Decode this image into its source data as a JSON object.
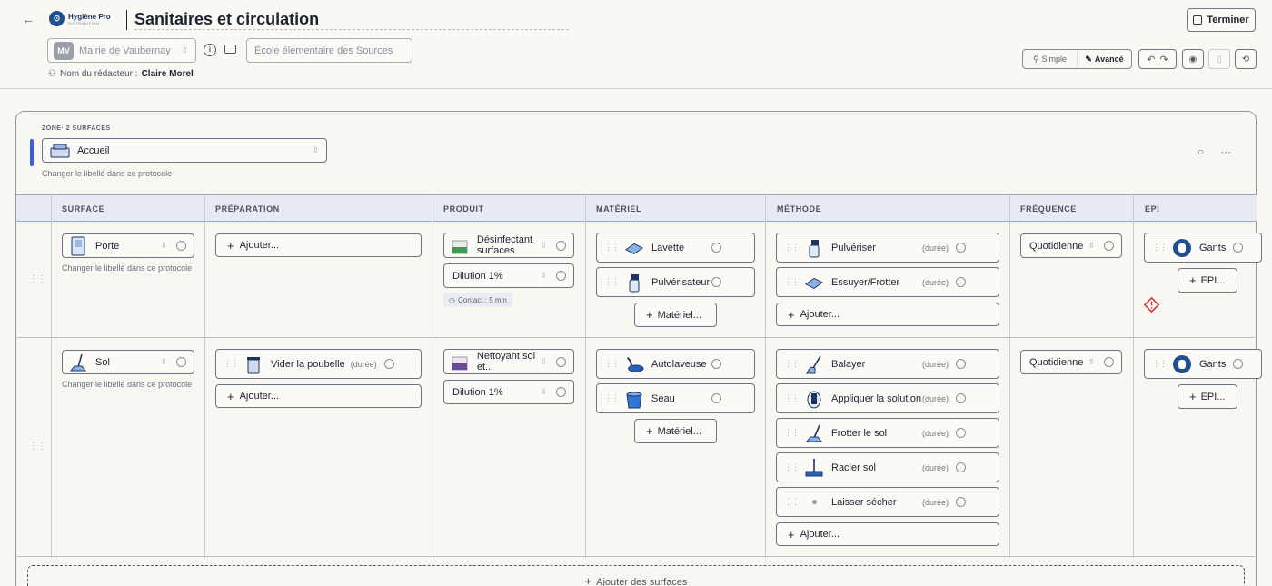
{
  "header": {
    "brand": "Hygiène Pro",
    "brand_sub": "DISTRIBUTION",
    "title": "Sanitaires et circulation",
    "finish_label": "Terminer",
    "client_initials": "MV",
    "client": "Mairie de Vaubernay",
    "site": "École élémentaire des Sources",
    "redactor_label": "Nom du rédacteur :",
    "redactor": "Claire Morel",
    "mode_simple": "Simple",
    "mode_advanced": "Avancé"
  },
  "zone": {
    "label": "ZONE· 2 SURFACES",
    "name": "Accueil",
    "hint": "Changer le libellé dans ce protocole"
  },
  "columns": [
    "SURFACE",
    "PRÉPARATION",
    "PRODUIT",
    "MATÉRIEL",
    "MÉTHODE",
    "FRÉQUENCE",
    "EPI"
  ],
  "rows": [
    {
      "surface": "Porte",
      "surface_hint": "Changer le libellé dans ce protocole",
      "preparation_add": "Ajouter...",
      "product": "Désinfectant surfaces",
      "dilution": "Dilution 1%",
      "contact": "Contact : 5 min",
      "materials": [
        "Lavette",
        "Pulvérisateur"
      ],
      "material_add": "Matériel...",
      "methods": [
        {
          "label": "Pulvériser",
          "dur": "(durée)"
        },
        {
          "label": "Essuyer/Frotter",
          "dur": "(durée)"
        }
      ],
      "method_add": "Ajouter...",
      "frequency": "Quotidienne",
      "epi": "Gants",
      "epi_add": "EPI..."
    },
    {
      "surface": "Sol",
      "surface_hint": "Changer le libellé dans ce protocole",
      "preparation": {
        "label": "Vider la poubelle",
        "dur": "(durée)"
      },
      "preparation_add": "Ajouter...",
      "product": "Nettoyant sol et...",
      "dilution": "Dilution 1%",
      "materials": [
        "Autolaveuse",
        "Seau"
      ],
      "material_add": "Matériel...",
      "methods": [
        {
          "label": "Balayer",
          "dur": "(durée)"
        },
        {
          "label": "Appliquer la solution",
          "dur": "(durée)"
        },
        {
          "label": "Frotter le sol",
          "dur": "(durée)"
        },
        {
          "label": "Racler sol",
          "dur": "(durée)"
        },
        {
          "label": "Laisser sécher",
          "dur": "(durée)"
        }
      ],
      "method_add": "Ajouter...",
      "frequency": "Quotidienne",
      "epi": "Gants",
      "epi_add": "EPI..."
    }
  ],
  "add_surfaces": "Ajouter des surfaces",
  "colors": {
    "accent": "#3c5bd6",
    "brand": "#1f4f91",
    "warn": "#d32f2f"
  }
}
